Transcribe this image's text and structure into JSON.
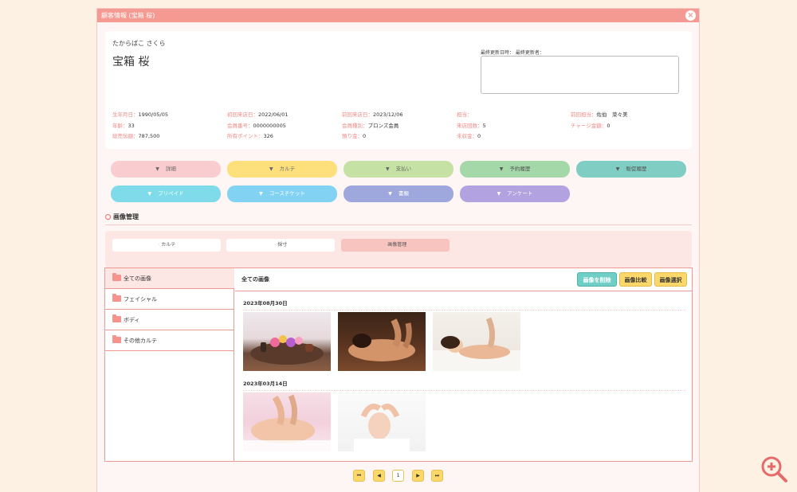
{
  "window": {
    "title": "顧客情報 (宝箱 桜)",
    "close_label": "×"
  },
  "customer": {
    "kana": "たからばこ さくら",
    "name": "宝箱 桜",
    "update_label": "最終更新日時：  最終更新者：",
    "info": [
      {
        "k": "生年月日：",
        "v": "1990/05/05"
      },
      {
        "k": "初回来店日：",
        "v": "2022/06/01"
      },
      {
        "k": "前回来店日：",
        "v": "2023/12/06"
      },
      {
        "k": "担当：",
        "v": ""
      },
      {
        "k": "前回担当：",
        "v": "佐伯　菜々美"
      },
      {
        "k": "年齢：",
        "v": "33"
      },
      {
        "k": "会員番号：",
        "v": "0000000005"
      },
      {
        "k": "会員種別：",
        "v": "ブロンズ会員"
      },
      {
        "k": "来店回数：",
        "v": "5"
      },
      {
        "k": "チャージ金額：",
        "v": "0"
      },
      {
        "k": "総売伝額：",
        "v": "787,500"
      },
      {
        "k": "所有ポイント：",
        "v": "326"
      },
      {
        "k": "預り金：",
        "v": "0"
      },
      {
        "k": "未収金：",
        "v": "0"
      }
    ]
  },
  "tabs": [
    {
      "label": "詳細",
      "color": "#f9cdd0"
    },
    {
      "label": "カルテ",
      "color": "#fde07c"
    },
    {
      "label": "支払い",
      "color": "#c5e2a4"
    },
    {
      "label": "予約履歴",
      "color": "#a4d8a8"
    },
    {
      "label": "販促履歴",
      "color": "#7fcdc3"
    },
    {
      "label": "プリペイド",
      "color": "#7fdbe9"
    },
    {
      "label": "コースチケット",
      "color": "#82d2f4"
    },
    {
      "label": "書類",
      "color": "#9fa8dc"
    },
    {
      "label": "アンケート",
      "color": "#b3a2e0"
    }
  ],
  "section": {
    "title": "画像管理"
  },
  "subtabs": [
    {
      "label": "カルテ"
    },
    {
      "label": "採寸"
    },
    {
      "label": "画像管理"
    }
  ],
  "folders": [
    {
      "label": "全ての画像"
    },
    {
      "label": "フェイシャル"
    },
    {
      "label": "ボディ"
    },
    {
      "label": "その他カルテ"
    }
  ],
  "gallery": {
    "title": "全ての画像",
    "delete_label": "画像を削除",
    "compare_label": "画像比較",
    "select_label": "画像選択",
    "groups": [
      {
        "date": "2023年08月30日"
      },
      {
        "date": "2023年03月14日"
      }
    ]
  },
  "pager": {
    "first": "⏮",
    "prev": "◀",
    "page": "1",
    "next": "▶",
    "last": "⏭"
  },
  "colors": {
    "accent": "#f59a92",
    "border": "#f09a94"
  }
}
